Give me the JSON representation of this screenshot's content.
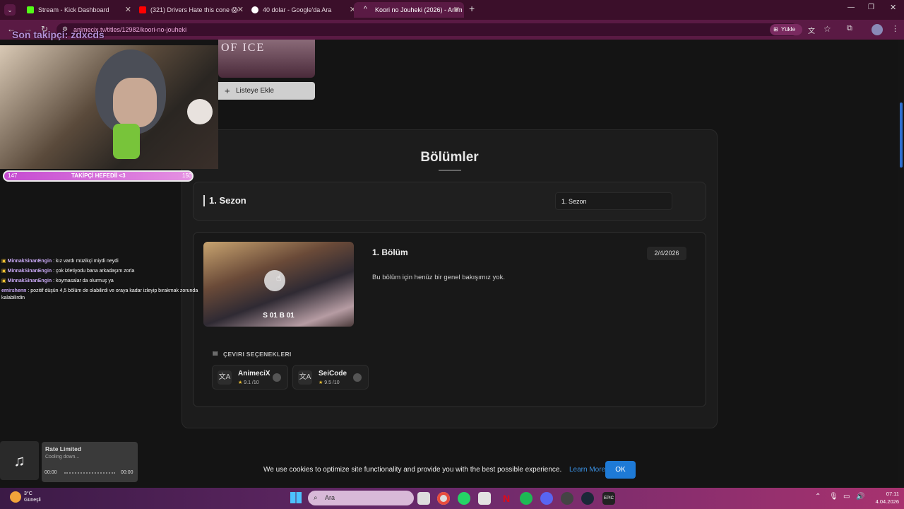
{
  "browser": {
    "tabs": [
      {
        "title": "Stream - Kick Dashboard",
        "favicon_color": "#53fc18"
      },
      {
        "title": "(321) Drivers Hate this cone 😱",
        "favicon_color": "#ff0000"
      },
      {
        "title": "40 dolar - Google'da Ara",
        "favicon_color": "#4285f4"
      },
      {
        "title": "Koori no Jouheki (2026) - Anim",
        "favicon_color": "#ffffff"
      }
    ],
    "url": "animecix.tv/titles/12982/koori-no-jouheki",
    "install_label": "Yükle"
  },
  "overlay": {
    "last_follower": "Son takipçi: zdxcds",
    "goal": {
      "current": "147",
      "label": "TAKİPÇİ HEFEDİİ <3",
      "target": "150",
      "progress": 0.98
    },
    "chat": [
      {
        "user": "MinnakSinanEngin",
        "text": ": kız vardı müzikçi miydi neydi"
      },
      {
        "user": "MinnakSinanEngin",
        "text": ": çok izletiyodu bana arkadaşım zorla"
      },
      {
        "user": "MinnakSinanEngin",
        "text": ": koymasalar da olurmuş ya"
      },
      {
        "user": "emirshenn",
        "text": ": pozitif düşün 4,5 bölüm de olabilirdi ve oraya kadar izleyip bırakmak zorunda kalabilirdin"
      }
    ]
  },
  "music": {
    "title": "Rate Limited",
    "status": "Cooling down...",
    "time_start": "00:00",
    "time_end": "00:00"
  },
  "anime": {
    "poster_text": "OF ICE",
    "add_to_list": "Listeye Ekle",
    "section_title": "Bölümler",
    "season_title": "1. Sezon",
    "season_select": "1. Sezon",
    "episode": {
      "code": "S 01 B 01",
      "title": "1. Bölüm",
      "date": "2/4/2026",
      "description": "Bu bölüm için henüz bir genel bakışımız yok."
    },
    "translations_header": "ÇEVIRI SEÇENEKLERI",
    "translations": [
      {
        "name": "AnimeciX",
        "rating": "9.1",
        "scale": "/10"
      },
      {
        "name": "SeiCode",
        "rating": "9.5",
        "scale": "/10"
      }
    ]
  },
  "cookie": {
    "text": "We use cookies to optimize site functionality and provide you with the best possible experience.",
    "learn_more": "Learn More",
    "ok": "OK"
  },
  "taskbar": {
    "weather_temp": "3°C",
    "weather_desc": "Güneşli",
    "search_placeholder": "Ara",
    "time": "07:11",
    "date": "4.04.2026"
  }
}
